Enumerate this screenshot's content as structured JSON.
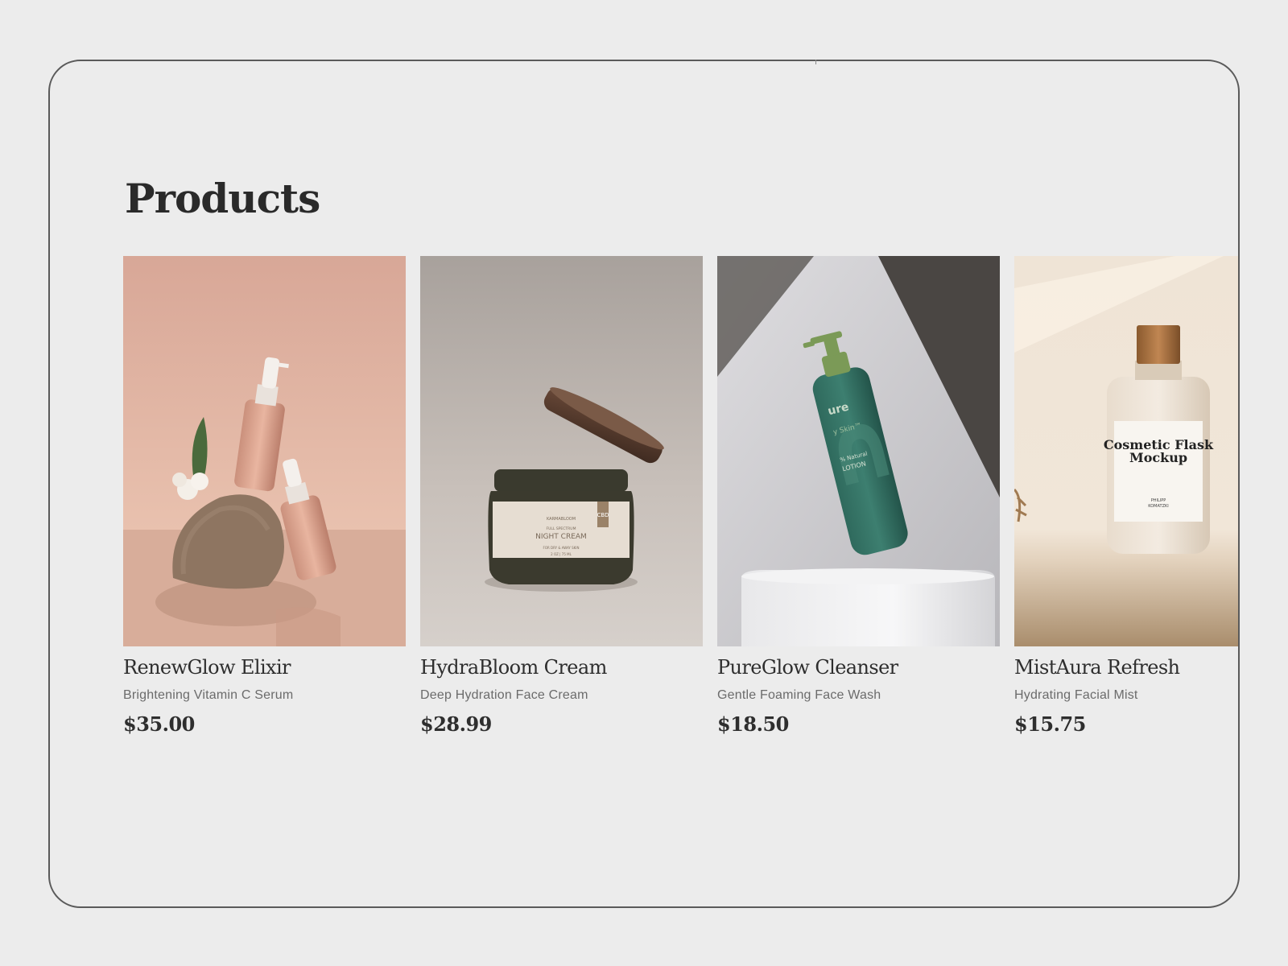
{
  "page": {
    "title": "Products"
  },
  "products": [
    {
      "name": "RenewGlow Elixir",
      "description": "Brightening Vitamin C Serum",
      "price": "$35.00",
      "image": "serum-bottles-on-stone"
    },
    {
      "name": "HydraBloom Cream",
      "description": "Deep Hydration Face Cream",
      "price": "$28.99",
      "image": "night-cream-jar",
      "label": {
        "brand": "KARMABLOOM",
        "line": "FULL SPECTRUM",
        "product": "NIGHT CREAM",
        "note": "FOR DRY & AWAY SKIN",
        "size": "2 OZ | 75 ML",
        "tag": "CBD"
      }
    },
    {
      "name": "PureGlow Cleanser",
      "description": "Gentle Foaming Face Wash",
      "price": "$18.50",
      "image": "green-pump-bottle",
      "label": {
        "brand": "ure",
        "line": "y Skin™",
        "type": "% Natural",
        "product": "LOTION"
      }
    },
    {
      "name": "MistAura Refresh",
      "description": "Hydrating Facial Mist",
      "price": "$15.75",
      "image": "cosmetic-flask",
      "label": {
        "title_line1": "Cosmetic Flask",
        "title_line2": "Mockup",
        "maker_line1": "PHILIPP",
        "maker_line2": "KOMATZKI"
      }
    }
  ]
}
